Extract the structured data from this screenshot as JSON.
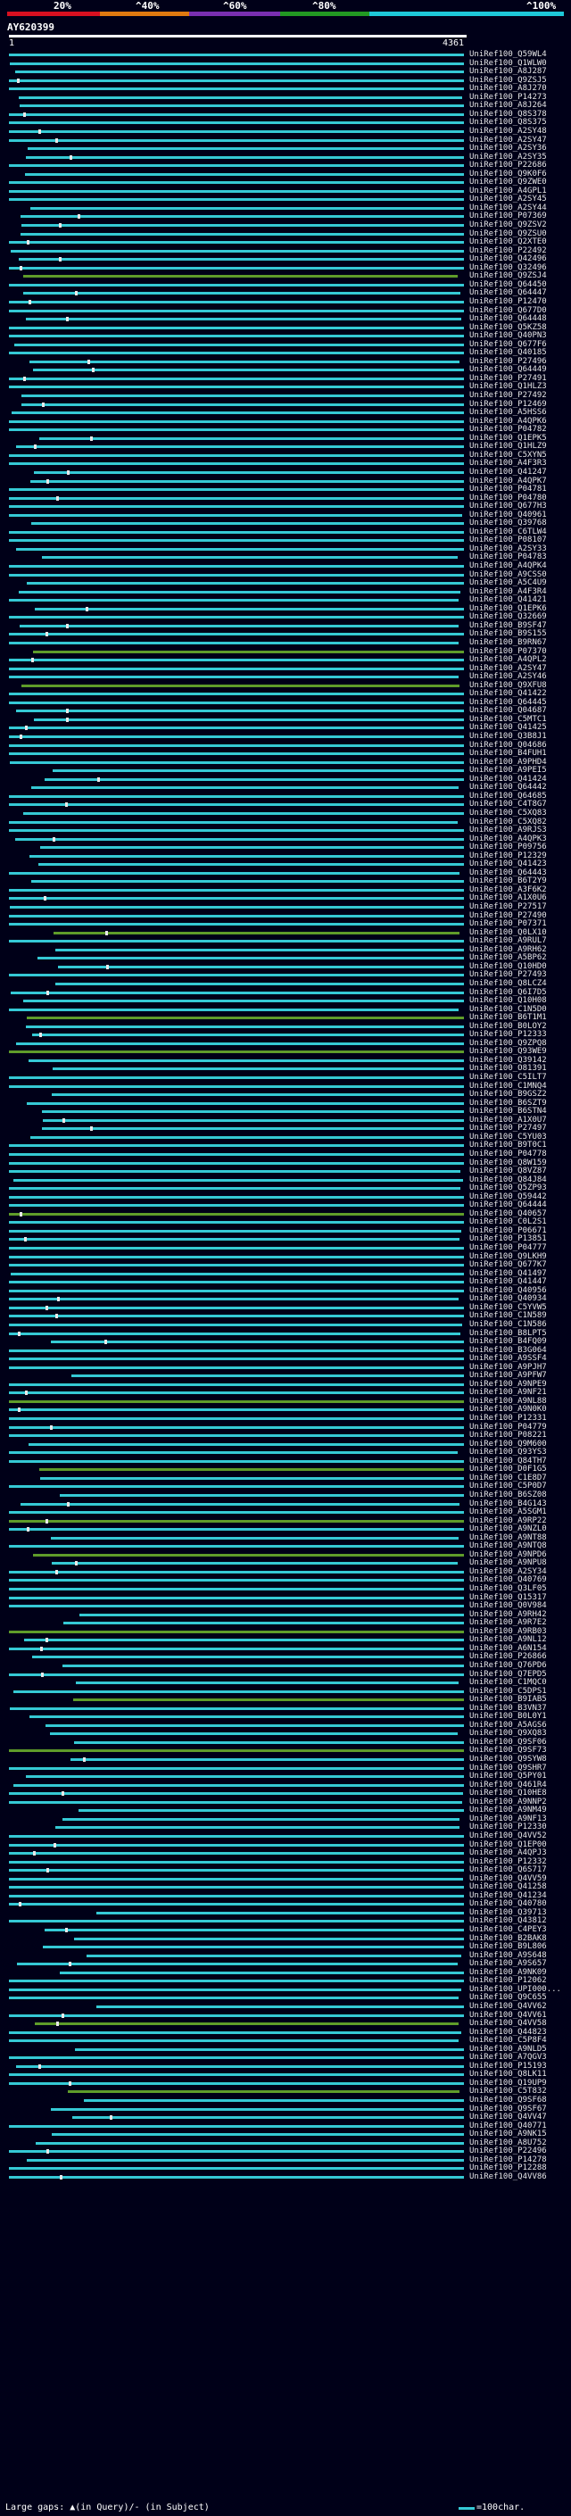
{
  "legend": {
    "labels": [
      "20%",
      "^40%",
      "^60%",
      "^80%",
      "^100%"
    ],
    "colors": [
      "#d81020",
      "#e07a10",
      "#7a2fb0",
      "#229922",
      "#1ec8d8"
    ]
  },
  "query": {
    "id": "AY620399",
    "start": "1",
    "end": "4361"
  },
  "accent_colors": {
    "hit": "#35c9d5",
    "partial_hit": "#5f9c2a",
    "gap": "#e8e8e8"
  },
  "hits": [
    "UniRef100_Q59WL4",
    "UniRef100_Q1WLW0",
    "UniRef100_A8J287",
    "UniRef100_Q9ZSJ5",
    "UniRef100_A8J270",
    "UniRef100_P14273",
    "UniRef100_A8J264",
    "UniRef100_Q8S378",
    "UniRef100_Q8S375",
    "UniRef100_A2SY48",
    "UniRef100_A2SY47",
    "UniRef100_A2SY36",
    "UniRef100_A2SY35",
    "UniRef100_P22686",
    "UniRef100_Q9K0F6",
    "UniRef100_Q9ZWE0",
    "UniRef100_A4GPL1",
    "UniRef100_A2SY45",
    "UniRef100_A2SY44",
    "UniRef100_P07369",
    "UniRef100_Q9ZSV2",
    "UniRef100_Q9ZSU0",
    "UniRef100_Q2XTE0",
    "UniRef100_P22492",
    "UniRef100_Q42496",
    "UniRef100_Q32496",
    "UniRef100_Q9ZSJ4",
    "UniRef100_Q64450",
    "UniRef100_Q64447",
    "UniRef100_P12470",
    "UniRef100_Q677D0",
    "UniRef100_Q64448",
    "UniRef100_Q5KZ58",
    "UniRef100_Q40PN3",
    "UniRef100_Q677F6",
    "UniRef100_Q40185",
    "UniRef100_P27496",
    "UniRef100_Q64449",
    "UniRef100_P27491",
    "UniRef100_Q1HLZ3",
    "UniRef100_P27492",
    "UniRef100_P12469",
    "UniRef100_A5HSS6",
    "UniRef100_A4QPK6",
    "UniRef100_P04782",
    "UniRef100_Q1EPK5",
    "UniRef100_Q1HLZ9",
    "UniRef100_C5XYN5",
    "UniRef100_A4F3R3",
    "UniRef100_Q41247",
    "UniRef100_A4QPK7",
    "UniRef100_P04781",
    "UniRef100_P04780",
    "UniRef100_Q677H3",
    "UniRef100_Q40961",
    "UniRef100_Q39768",
    "UniRef100_C6TLW4",
    "UniRef100_P08107",
    "UniRef100_A2SY33",
    "UniRef100_P04783",
    "UniRef100_A4QPK4",
    "UniRef100_A9CSS0",
    "UniRef100_A5C4U9",
    "UniRef100_A4F3R4",
    "UniRef100_Q41421",
    "UniRef100_Q1EPK6",
    "UniRef100_Q32669",
    "UniRef100_B9SF47",
    "UniRef100_B9S155",
    "UniRef100_B9RN67",
    "UniRef100_P07370",
    "UniRef100_A4QPL2",
    "UniRef100_A2SY47",
    "UniRef100_A2SY46",
    "UniRef100_Q9XFU8",
    "UniRef100_Q41422",
    "UniRef100_Q64445",
    "UniRef100_Q04687",
    "UniRef100_C5MTC1",
    "UniRef100_Q41425",
    "UniRef100_Q3B8J1",
    "UniRef100_Q04686",
    "UniRef100_B4FUH1",
    "UniRef100_A9PHD4",
    "UniRef100_A9PEI5",
    "UniRef100_Q41424",
    "UniRef100_Q64442",
    "UniRef100_Q64685",
    "UniRef100_C4T8G7",
    "UniRef100_C5XQ83",
    "UniRef100_C5XQ82",
    "UniRef100_A9RJS3",
    "UniRef100_A4QPK3",
    "UniRef100_P09756",
    "UniRef100_P12329",
    "UniRef100_Q41423",
    "UniRef100_Q64443",
    "UniRef100_B6T2Y9",
    "UniRef100_A3F6K2",
    "UniRef100_A1X0U6",
    "UniRef100_P27517",
    "UniRef100_P27490",
    "UniRef100_P07371",
    "UniRef100_Q0LX10",
    "UniRef100_A9RUL7",
    "UniRef100_A9RH62",
    "UniRef100_A5BP62",
    "UniRef100_Q10HD0",
    "UniRef100_P27493",
    "UniRef100_Q8LCZ4",
    "UniRef100_Q6I7D5",
    "UniRef100_Q10H08",
    "UniRef100_C1N5D0",
    "UniRef100_B6T1M1",
    "UniRef100_B0LOY2",
    "UniRef100_P12333",
    "UniRef100_Q9ZPQ8",
    "UniRef100_Q93WE9",
    "UniRef100_Q39142",
    "UniRef100_O81391",
    "UniRef100_C5ILT7",
    "UniRef100_C1MNQ4",
    "UniRef100_B9GSZ2",
    "UniRef100_B6SZT9",
    "UniRef100_B6STN4",
    "UniRef100_A1X0U7",
    "UniRef100_P27497",
    "UniRef100_C5YU03",
    "UniRef100_B9T0C1",
    "UniRef100_P04778",
    "UniRef100_Q8W159",
    "UniRef100_Q8VZ87",
    "UniRef100_Q84J84",
    "UniRef100_Q5ZP93",
    "UniRef100_Q59442",
    "UniRef100_Q64444",
    "UniRef100_Q40657",
    "UniRef100_C0L2S1",
    "UniRef100_P06671",
    "UniRef100_P13851",
    "UniRef100_P04777",
    "UniRef100_Q9LKH9",
    "UniRef100_Q677K7",
    "UniRef100_Q41497",
    "UniRef100_Q41447",
    "UniRef100_Q40956",
    "UniRef100_Q40934",
    "UniRef100_C5YVW5",
    "UniRef100_C1N589",
    "UniRef100_C1N586",
    "UniRef100_B8LPT5",
    "UniRef100_B4FQ09",
    "UniRef100_B3G064",
    "UniRef100_A9SSF4",
    "UniRef100_A9PJH7",
    "UniRef100_A9PFW7",
    "UniRef100_A9NPE9",
    "UniRef100_A9NF21",
    "UniRef100_A9NL88",
    "UniRef100_A9N0K0",
    "UniRef100_P12331",
    "UniRef100_P04779",
    "UniRef100_P08221",
    "UniRef100_Q9M600",
    "UniRef100_Q93YS3",
    "UniRef100_Q84TH7",
    "UniRef100_D0F1G5",
    "UniRef100_C1E8D7",
    "UniRef100_C5P0D7",
    "UniRef100_B6SZ08",
    "UniRef100_B4G143",
    "UniRef100_A5SGM1",
    "UniRef100_A9RP22",
    "UniRef100_A9NZL0",
    "UniRef100_A9NT88",
    "UniRef100_A9NTQ8",
    "UniRef100_A9NPD6",
    "UniRef100_A9NPU8",
    "UniRef100_A2SY34",
    "UniRef100_Q40769",
    "UniRef100_Q3LF05",
    "UniRef100_Q15317",
    "UniRef100_Q0V984",
    "UniRef100_A9RH42",
    "UniRef100_A9R7E2",
    "UniRef100_A9RB03",
    "UniRef100_A9NL12",
    "UniRef100_A6N154",
    "UniRef100_P26866",
    "UniRef100_Q76PD6",
    "UniRef100_Q7EPD5",
    "UniRef100_C1MQC0",
    "UniRef100_C5DPS1",
    "UniRef100_B9IAB5",
    "UniRef100_B3VN37",
    "UniRef100_B0L0Y1",
    "UniRef100_A5AGS6",
    "UniRef100_Q9XQ83",
    "UniRef100_Q9SF06",
    "UniRef100_Q9SF73",
    "UniRef100_Q9SYW8",
    "UniRef100_Q9SHR7",
    "UniRef100_Q5PY01",
    "UniRef100_Q461R4",
    "UniRef100_Q10HE8",
    "UniRef100_A9NNP2",
    "UniRef100_A9NM49",
    "UniRef100_A9NF13",
    "UniRef100_P12330",
    "UniRef100_Q4VV52",
    "UniRef100_Q1EP00",
    "UniRef100_A4QPJ3",
    "UniRef100_P12332",
    "UniRef100_Q6S717",
    "UniRef100_Q4VV59",
    "UniRef100_Q41258",
    "UniRef100_Q41234",
    "UniRef100_Q40780",
    "UniRef100_Q39713",
    "UniRef100_Q43812",
    "UniRef100_C4PEY3",
    "UniRef100_B2BAK8",
    "UniRef100_B9L806",
    "UniRef100_A9S648",
    "UniRef100_A9S657",
    "UniRef100_A9NK09",
    "UniRef100_P12062",
    "UniRef100_UPI000...",
    "UniRef100_Q9C655",
    "UniRef100_Q4VV62",
    "UniRef100_Q4VV61",
    "UniRef100_Q4VV58",
    "UniRef100_Q44823",
    "UniRef100_C5P8F4",
    "UniRef100_A9NLD5",
    "UniRef100_A7QGV3",
    "UniRef100_P15193",
    "UniRef100_Q8LK11",
    "UniRef100_Q19UP9",
    "UniRef100_C5T832",
    "UniRef100_Q9SF68",
    "UniRef100_Q9SF67",
    "UniRef100_Q4VV47",
    "UniRef100_Q40771",
    "UniRef100_A9NK15",
    "UniRef100_A8U752",
    "UniRef100_P22496",
    "UniRef100_P14278",
    "UniRef100_P12288",
    "UniRef100_Q4VV86"
  ],
  "footer": {
    "gap_legend": "Large gaps: ▲(in Query)/- (in Subject)",
    "scale_legend": "=100char."
  }
}
